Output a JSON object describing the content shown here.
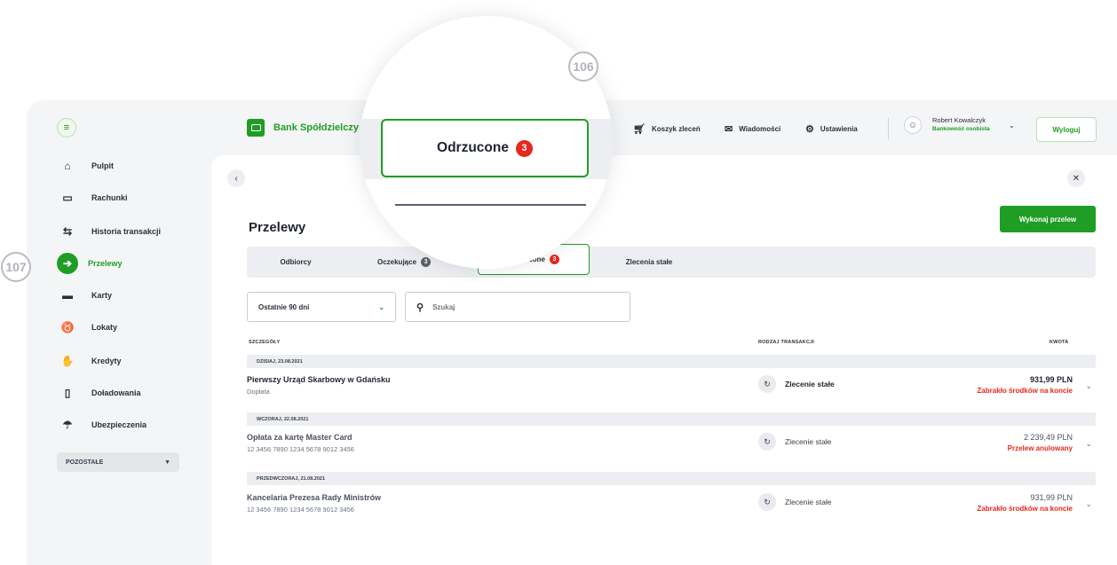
{
  "callouts": {
    "magnifier": "106",
    "sidebar": "107"
  },
  "brand": {
    "name": "Bank Spółdzielczy",
    "color": "#1f9d24"
  },
  "sidebar": {
    "items": [
      {
        "label": "Pulpit",
        "icon": "home-icon"
      },
      {
        "label": "Rachunki",
        "icon": "wallet-icon"
      },
      {
        "label": "Historia transakcji",
        "icon": "transfer-arrows-icon"
      },
      {
        "label": "Przelewy",
        "icon": "arrow-right-circle-icon",
        "active": true
      },
      {
        "label": "Karty",
        "icon": "card-icon"
      },
      {
        "label": "Lokaty",
        "icon": "piggy-bank-icon"
      },
      {
        "label": "Kredyty",
        "icon": "hand-coin-icon"
      },
      {
        "label": "Doładowania",
        "icon": "phone-icon"
      },
      {
        "label": "Ubezpieczenia",
        "icon": "umbrella-icon"
      }
    ],
    "more_label": "POZOSTAŁE"
  },
  "topbar": {
    "cart_label": "Koszyk zleceń",
    "messages_label": "Wiadomości",
    "settings_label": "Ustawienia",
    "user_name": "Robert Kowalczyk",
    "user_role": "Bankowość osobista",
    "logout_label": "Wyloguj"
  },
  "page": {
    "title": "Przelewy",
    "primary_button": "Wykonaj przelew"
  },
  "tabs": [
    {
      "label": "Odbiorcy",
      "badge": ""
    },
    {
      "label": "Oczekujące",
      "badge": "3"
    },
    {
      "label": "Odrzucone",
      "badge": "3",
      "active": true
    },
    {
      "label": "Zlecenia stałe",
      "badge": ""
    }
  ],
  "magnifier": {
    "label": "Odrzucone",
    "badge": "3"
  },
  "filters": {
    "period_value": "Ostatnie 90 dni",
    "search_placeholder": "Szukaj"
  },
  "table": {
    "columns": {
      "details": "SZCZEGÓŁY",
      "type": "RODZAJ TRANSAKCJI",
      "amount": "KWOTA"
    },
    "groups": [
      {
        "date": "DZISIAJ, 23.08.2021",
        "title": "Pierwszy Urząd Skarbowy w Gdańsku",
        "sub": "Dopłata",
        "type": "Zlecenie stałe",
        "amount": "931,99 PLN",
        "status": "Zabrakło środków na koncie"
      },
      {
        "date": "WCZORAJ, 22.08.2021",
        "title": "Opłata za kartę Master Card",
        "sub": "12 3456 7890 1234 5678 9012 3456",
        "type": "Zlecenie stałe",
        "amount": "2 239,49 PLN",
        "status": "Przelew anulowany"
      },
      {
        "date": "PRZEDWCZORAJ, 21.08.2021",
        "title": "Kancelaria Prezesa Rady Ministrów",
        "sub": "12 3456 7890 1234 5678 9012 3456",
        "type": "Zlecenie stałe",
        "amount": "931,99 PLN",
        "status": "Zabrakło środków na koncie"
      }
    ]
  }
}
